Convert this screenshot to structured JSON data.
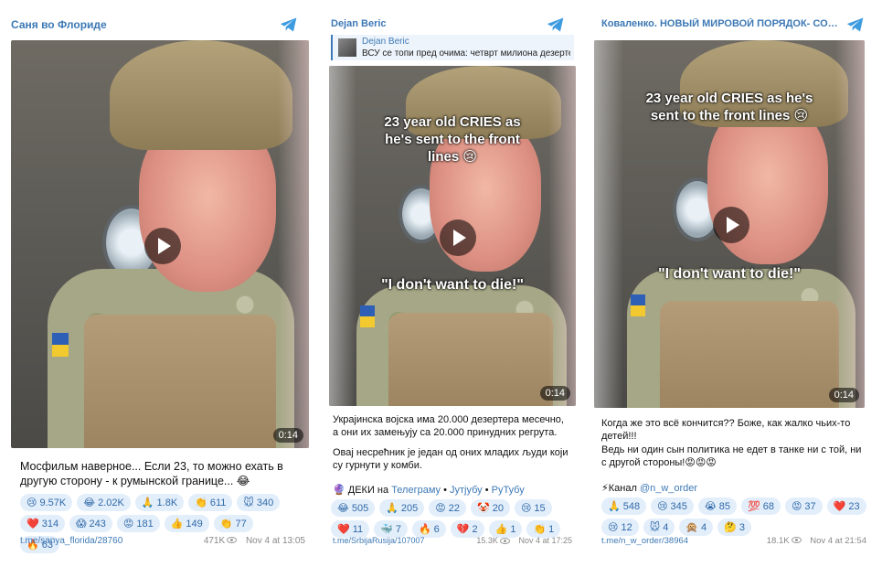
{
  "posts": [
    {
      "channel": "Саня во Флориде",
      "video": {
        "duration": "0:14",
        "caption_top": "",
        "caption_bottom": ""
      },
      "text": [
        "Мосфильм наверное... Если 23, то можно ехать в другую сторону - к румынской границе... 😂"
      ],
      "reactions": [
        {
          "emoji": "😢",
          "count": "9.57K"
        },
        {
          "emoji": "😂",
          "count": "2.02K"
        },
        {
          "emoji": "🙏",
          "count": "1.8K"
        },
        {
          "emoji": "👏",
          "count": "611"
        },
        {
          "emoji": "🐭",
          "count": "340"
        },
        {
          "emoji": "❤️",
          "count": "314"
        },
        {
          "emoji": "😱",
          "count": "243"
        },
        {
          "emoji": "😡",
          "count": "181"
        },
        {
          "emoji": "👍",
          "count": "149"
        },
        {
          "emoji": "👏",
          "count": "77"
        },
        {
          "emoji": "🔥",
          "count": "63"
        }
      ],
      "url": "t.me/sanya_florida/28760",
      "views": "471K",
      "date": "Nov 4 at 13:05"
    },
    {
      "channel": "Dejan Beric",
      "forward": {
        "name": "Dejan Beric",
        "text": "ВСУ се топи пред очима: четврт милиона дезертера"
      },
      "video": {
        "duration": "0:14",
        "caption_top": "23 year old CRIES as he's sent to the front lines 😢",
        "caption_bottom": "\"I don't want to die!\""
      },
      "text": [
        "Украјинска војска има 20.000 дезертера месечно, а они их замењују са 20.000 принудних регрута.",
        "Овај несрећник је један од оних младих људи који су гурнути у комби."
      ],
      "links": {
        "prefix_emoji": "🔮",
        "deki": "ДЕКИ",
        "na": " на ",
        "telegram": "Телеграму",
        "youtube": "Јутјубу",
        "rutube": "РуТубу",
        "sep": " • "
      },
      "reactions": [
        {
          "emoji": "😂",
          "count": "505"
        },
        {
          "emoji": "🙏",
          "count": "205"
        },
        {
          "emoji": "😡",
          "count": "22"
        },
        {
          "emoji": "🤡",
          "count": "20"
        },
        {
          "emoji": "😢",
          "count": "15"
        },
        {
          "emoji": "❤️",
          "count": "11"
        },
        {
          "emoji": "🐳",
          "count": "7"
        },
        {
          "emoji": "🔥",
          "count": "6"
        },
        {
          "emoji": "💔",
          "count": "2"
        },
        {
          "emoji": "👍",
          "count": "1"
        },
        {
          "emoji": "👏",
          "count": "1"
        }
      ],
      "url": "t.me/SrbijaRusija/107007",
      "views": "15.3K",
      "date": "Nov 4 at 17:25"
    },
    {
      "channel": "Коваленко. НОВЫЙ МИРОВОЙ ПОРЯДОК- СОПРО...",
      "video": {
        "duration": "0:14",
        "caption_top": "23 year old CRIES as he's sent to the front lines 😢",
        "caption_bottom": "\"I don't want to die!\""
      },
      "text": [
        "Когда же это всё кончится?? Боже, как жалко чьих-то детей!!!",
        "Ведь ни один сын политика не едет в танке ни с той, ни с другой стороны!😡😡😡"
      ],
      "links": {
        "prefix_emoji": "⚡",
        "channel_word": "Канал ",
        "handle": "@n_w_order"
      },
      "reactions": [
        {
          "emoji": "🙏",
          "count": "548"
        },
        {
          "emoji": "😢",
          "count": "345"
        },
        {
          "emoji": "😭",
          "count": "85"
        },
        {
          "emoji": "💯",
          "count": "68"
        },
        {
          "emoji": "😡",
          "count": "37"
        },
        {
          "emoji": "❤️",
          "count": "23"
        },
        {
          "emoji": "😢",
          "count": "12"
        },
        {
          "emoji": "🐭",
          "count": "4"
        },
        {
          "emoji": "🙊",
          "count": "4"
        },
        {
          "emoji": "🤔",
          "count": "3"
        }
      ],
      "url": "t.me/n_w_order/38964",
      "views": "18.1K",
      "date": "Nov 4 at 21:54"
    }
  ],
  "colors": {
    "accent": "#3d79b5",
    "chip_bg": "#e3eefb",
    "meta": "#888888"
  },
  "icons": {
    "header": "telegram-icon",
    "views": "eye-icon",
    "video": "play-icon"
  }
}
